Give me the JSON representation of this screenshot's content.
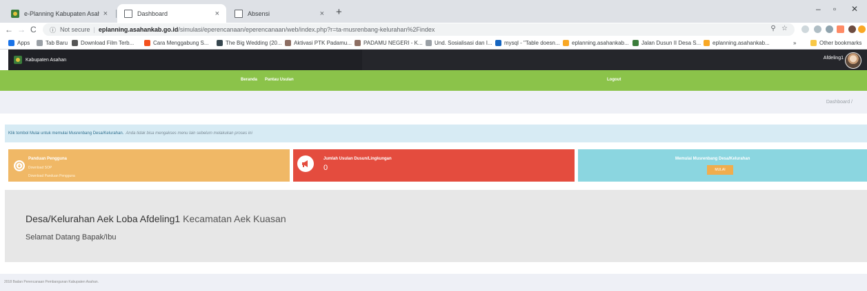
{
  "browser": {
    "tabs": [
      {
        "title": "e-Planning Kabupaten Asahan",
        "active": false
      },
      {
        "title": "Dashboard",
        "active": true
      },
      {
        "title": "Absensi",
        "active": false
      }
    ],
    "tab_close": "×",
    "new_tab": "+",
    "window": {
      "minimize": "–",
      "maximize": "▫",
      "close": "✕"
    },
    "nav": {
      "back": "←",
      "forward": "→",
      "reload": "C"
    },
    "address": {
      "security": "Not secure",
      "host": "eplanning.asahankab.go.id",
      "path": "/simulasi/eperencanaan/eperencanaan/web/index.php?r=ta-musrenbang-kelurahan%2Findex"
    },
    "bookmarks": [
      {
        "label": "Apps",
        "color": "#1a73e8"
      },
      {
        "label": "Tab Baru",
        "color": "#9aa0a6"
      },
      {
        "label": "Download Film Terb...",
        "color": "#555555"
      },
      {
        "label": "Cara Menggabung S...",
        "color": "#f4511e"
      },
      {
        "label": "The Big Wedding (20...",
        "color": "#37474f"
      },
      {
        "label": "Aktivasi PTK Padamu...",
        "color": "#8d6e63"
      },
      {
        "label": "PADAMU NEGERI - K...",
        "color": "#8d6e63"
      },
      {
        "label": "Und. Sosialisasi dan I...",
        "color": "#9aa0a6"
      },
      {
        "label": "mysql - \"Table doesn...",
        "color": "#1565c0"
      },
      {
        "label": "eplanning.asahankab...",
        "color": "#f9a825"
      },
      {
        "label": "Jalan Dusun II Desa S...",
        "color": "#3b7d3b"
      },
      {
        "label": "eplanning.asahankab...",
        "color": "#f9a825"
      }
    ],
    "bookmarks_overflow": "»",
    "other_bookmarks": "Other bookmarks"
  },
  "header": {
    "brand": "Kabupaten Asahan",
    "username": "Afdeling1"
  },
  "nav": {
    "items": [
      "Beranda",
      "Pantau Usulan"
    ],
    "logout": "Logout"
  },
  "breadcrumb": {
    "current": "Dashboard /"
  },
  "alert": {
    "text": "Klik tombol Mulai untuk memulai Musrenbang Desa/Kelurahan.",
    "note": "Anda tidak bisa mengakses menu lain sebelum melakukan proses ini"
  },
  "cards": {
    "guide": {
      "title": "Panduan Pengguna",
      "links": [
        "Download SOP",
        "Download Panduan Pengguna"
      ]
    },
    "proposals": {
      "title": "Jumlah Usulan Dusun/Lingkungan",
      "count": "0"
    },
    "start": {
      "title": "Memulai Musrenbang Desa/Kelurahan",
      "button": "MULAI"
    }
  },
  "main": {
    "village": "Desa/Kelurahan Aek Loba Afdeling1",
    "district": "Kecamatan Aek Kuasan",
    "welcome": "Selamat Datang Bapak/Ibu"
  },
  "footer": {
    "text": "2018 Badan Perencanaan Pembangunan Kabupaten Asahan."
  },
  "colors": {
    "nav_green": "#8bc34a",
    "card_yellow": "#f0b866",
    "card_red": "#e44c3e",
    "card_cyan": "#8bd6e0",
    "button_orange": "#f0ad4e"
  }
}
